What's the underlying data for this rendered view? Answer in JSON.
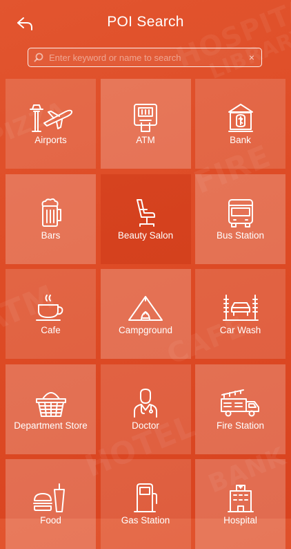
{
  "header": {
    "title": "POI Search"
  },
  "search": {
    "placeholder": "Enter keyword or name to search",
    "clear": "×"
  },
  "categories": [
    {
      "label": "Airports",
      "icon": "airport-icon"
    },
    {
      "label": "ATM",
      "icon": "atm-icon"
    },
    {
      "label": "Bank",
      "icon": "bank-icon"
    },
    {
      "label": "Bars",
      "icon": "beer-mug-icon"
    },
    {
      "label": "Beauty Salon",
      "icon": "salon-chair-icon"
    },
    {
      "label": "Bus Station",
      "icon": "bus-icon"
    },
    {
      "label": "Cafe",
      "icon": "coffee-cup-icon"
    },
    {
      "label": "Campground",
      "icon": "tent-icon"
    },
    {
      "label": "Car Wash",
      "icon": "car-wash-icon"
    },
    {
      "label": "Department Store",
      "icon": "shopping-basket-icon"
    },
    {
      "label": "Doctor",
      "icon": "doctor-icon"
    },
    {
      "label": "Fire Station",
      "icon": "fire-truck-icon"
    },
    {
      "label": "Food",
      "icon": "burger-drink-icon"
    },
    {
      "label": "Gas Station",
      "icon": "fuel-pump-icon"
    },
    {
      "label": "Hospital",
      "icon": "hospital-icon"
    }
  ],
  "colors": {
    "background": "#de4c26",
    "tile": "rgba(255,255,255,0.14)",
    "text": "#ffffff"
  }
}
